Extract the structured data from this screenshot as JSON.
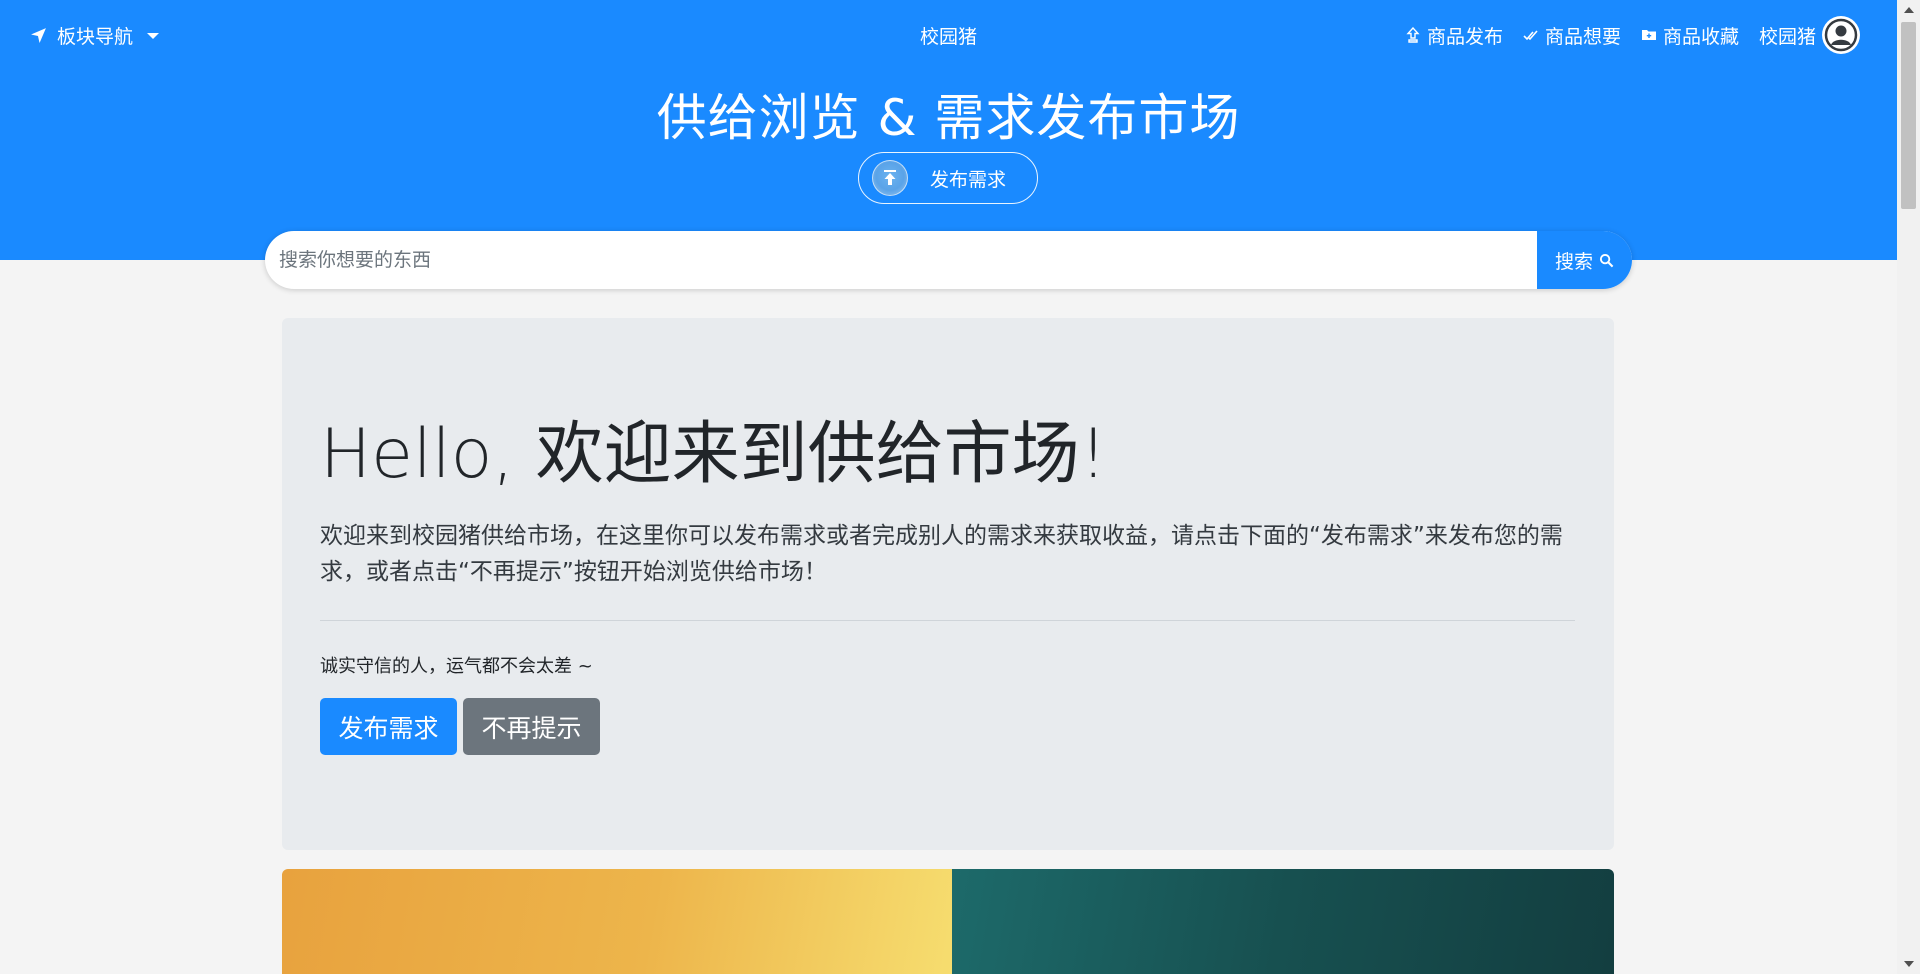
{
  "nav": {
    "section_nav_label": "板块导航",
    "brand": "校园猪",
    "links": [
      {
        "label": "商品发布",
        "icon": "upload-icon"
      },
      {
        "label": "商品想要",
        "icon": "double-check-icon"
      },
      {
        "label": "商品收藏",
        "icon": "folder-icon"
      }
    ],
    "user_name": "校园猪"
  },
  "hero": {
    "title": "供给浏览 & 需求发布市场",
    "publish_button_label": "发布需求"
  },
  "search": {
    "placeholder": "搜索你想要的东西",
    "button_label": "搜索"
  },
  "jumbotron": {
    "heading": "Hello, 欢迎来到供给市场!",
    "lead": "欢迎来到校园猪供给市场，在这里你可以发布需求或者完成别人的需求来获取收益，请点击下面的“发布需求”来发布您的需求，或者点击“不再提示”按钮开始浏览供给市场！",
    "motto": "诚实守信的人，运气都不会太差 ~",
    "primary_button": "发布需求",
    "secondary_button": "不再提示"
  },
  "colors": {
    "brand_blue": "#1a8aff",
    "secondary_gray": "#6c757d",
    "jumbotron_bg": "#e8ebee"
  }
}
